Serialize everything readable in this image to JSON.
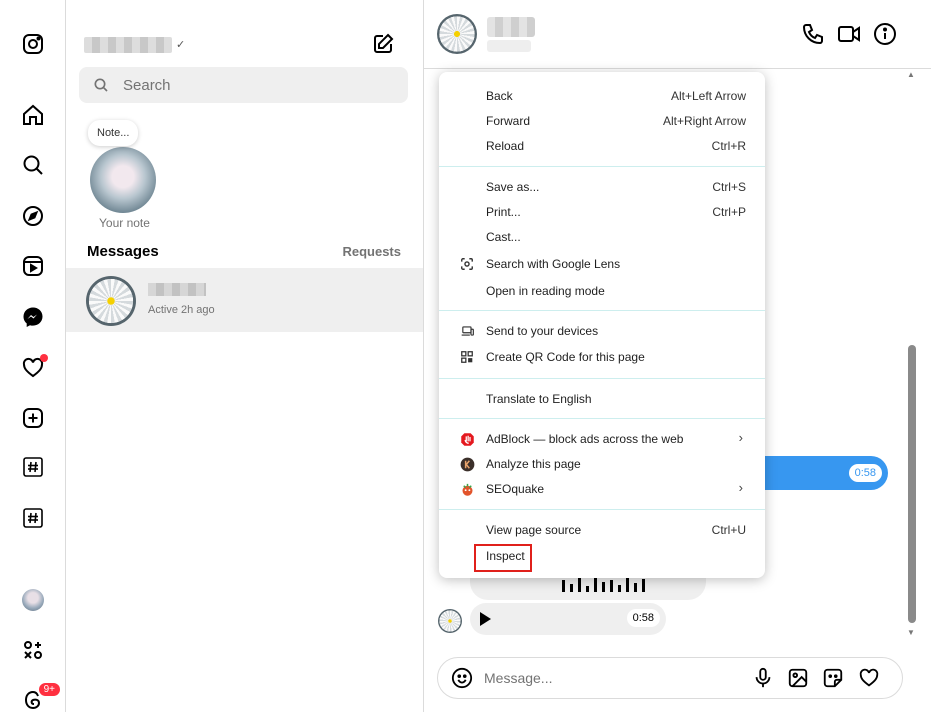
{
  "app": {
    "name": "Instagram",
    "notifications_count": "9+"
  },
  "sidebar": {
    "items": [
      {
        "name": "instagram-logo-icon"
      },
      {
        "name": "home-icon"
      },
      {
        "name": "search-icon"
      },
      {
        "name": "explore-icon"
      },
      {
        "name": "reels-icon"
      },
      {
        "name": "messenger-icon"
      },
      {
        "name": "heart-icon"
      },
      {
        "name": "create-icon"
      },
      {
        "name": "hashtag-icon"
      },
      {
        "name": "hashtag-icon-2"
      },
      {
        "name": "profile-avatar"
      },
      {
        "name": "more-apps-icon"
      },
      {
        "name": "threads-icon"
      }
    ]
  },
  "inbox": {
    "search_placeholder": "Search",
    "note_bubble": "Note...",
    "your_note": "Your note",
    "messages_heading": "Messages",
    "requests_link": "Requests",
    "conversations": [
      {
        "status": "Active 2h ago"
      }
    ]
  },
  "chat": {
    "blue_message_duration": "0:58",
    "audio_message_duration": "0:58",
    "message_placeholder": "Message..."
  },
  "context_menu": {
    "items": [
      {
        "label": "Back",
        "shortcut": "Alt+Left Arrow"
      },
      {
        "label": "Forward",
        "shortcut": "Alt+Right Arrow"
      },
      {
        "label": "Reload",
        "shortcut": "Ctrl+R"
      },
      {
        "label": "Save as...",
        "shortcut": "Ctrl+S"
      },
      {
        "label": "Print...",
        "shortcut": "Ctrl+P"
      },
      {
        "label": "Cast...",
        "shortcut": ""
      },
      {
        "label": "Search with Google Lens",
        "shortcut": "",
        "icon": "google-lens-icon"
      },
      {
        "label": "Open in reading mode",
        "shortcut": ""
      },
      {
        "label": "Send to your devices",
        "shortcut": "",
        "icon": "devices-icon"
      },
      {
        "label": "Create QR Code for this page",
        "shortcut": "",
        "icon": "qr-code-icon"
      },
      {
        "label": "Translate to English",
        "shortcut": ""
      },
      {
        "label": "AdBlock — block ads across the web",
        "shortcut": "",
        "icon": "adblock-icon",
        "submenu": true
      },
      {
        "label": "Analyze this page",
        "shortcut": "",
        "icon": "analyze-icon"
      },
      {
        "label": "SEOquake",
        "shortcut": "",
        "icon": "seoquake-icon",
        "submenu": true
      },
      {
        "label": "View page source",
        "shortcut": "Ctrl+U"
      },
      {
        "label": "Inspect",
        "shortcut": "",
        "highlighted": true
      }
    ],
    "highlight_color": "#e0201b"
  },
  "colors": {
    "accent_blue": "#3797f0",
    "notification_red": "#ff3040"
  }
}
